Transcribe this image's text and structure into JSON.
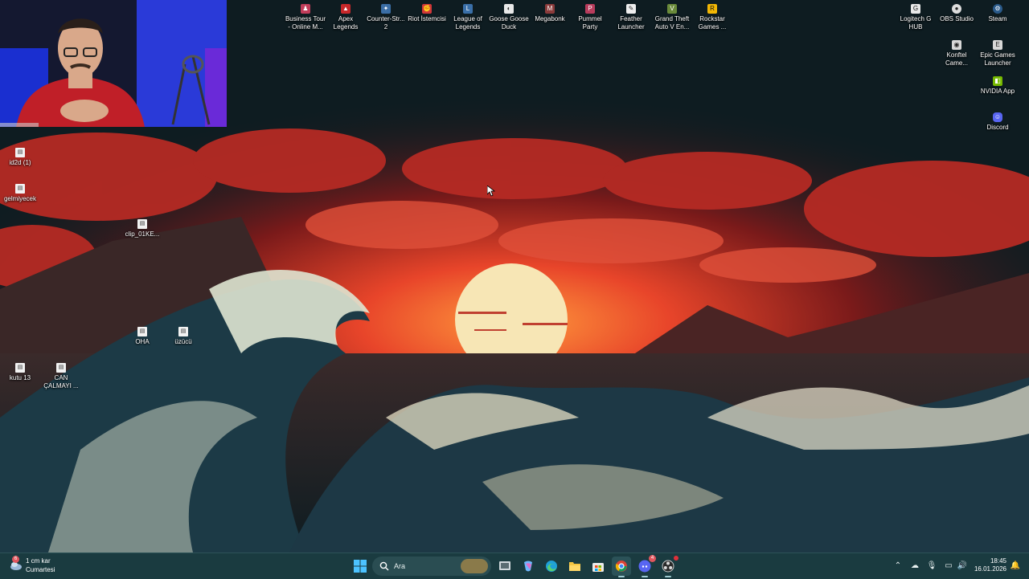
{
  "desktop": {
    "top_icons": [
      {
        "label": "Business Tour\n- Online M...",
        "icon": "business-tour-icon",
        "color": "#c23d5a"
      },
      {
        "label": "Apex\nLegends",
        "icon": "apex-legends-icon",
        "color": "#c8282a"
      },
      {
        "label": "Counter-Str...\n2",
        "icon": "counter-strike-icon",
        "color": "#3b6ea5"
      },
      {
        "label": "Riot İstemcisi",
        "icon": "riot-client-icon",
        "color": "#d13639"
      },
      {
        "label": "League of\nLegends",
        "icon": "league-of-legends-icon",
        "color": "#3a6fa8"
      },
      {
        "label": "Goose Goose\nDuck",
        "icon": "goose-goose-duck-icon",
        "color": "#e8e8e8"
      },
      {
        "label": "Megabonk",
        "icon": "megabonk-icon",
        "color": "#8a3b3b"
      },
      {
        "label": "Pummel\nParty",
        "icon": "pummel-party-icon",
        "color": "#b83c5c"
      },
      {
        "label": "Feather\nLauncher",
        "icon": "feather-launcher-icon",
        "color": "#eeeeee"
      },
      {
        "label": "Grand Theft\nAuto V En...",
        "icon": "gta-v-icon",
        "color": "#6a8a3a"
      },
      {
        "label": "Rockstar\nGames ...",
        "icon": "rockstar-games-icon",
        "color": "#f2b705"
      }
    ],
    "right_icons": [
      {
        "label": "Logitech G\nHUB",
        "icon": "logitech-g-hub-icon",
        "color": "#e8e8e8"
      },
      {
        "label": "OBS Studio",
        "icon": "obs-studio-icon",
        "color": "#dddddd"
      },
      {
        "label": "Steam",
        "icon": "steam-icon",
        "color": "#2a5a8a"
      },
      {
        "label": "Konftel\nCame...",
        "icon": "konftel-camera-icon",
        "color": "#d8d8d8"
      },
      {
        "label": "Epic Games\nLauncher",
        "icon": "epic-games-icon",
        "color": "#d8d8d8"
      },
      {
        "label": "NVIDIA App",
        "icon": "nvidia-app-icon",
        "color": "#76b900"
      },
      {
        "label": "Discord",
        "icon": "discord-icon",
        "color": "#5865f2"
      }
    ],
    "left_icons": [
      {
        "label": "id2d (1)",
        "icon": "file-icon"
      },
      {
        "label": "gelmiyecek",
        "icon": "file-icon"
      },
      {
        "label": "clip_01KE...",
        "icon": "file-icon"
      },
      {
        "label": "OHA",
        "icon": "file-icon"
      },
      {
        "label": "üzücü",
        "icon": "file-icon"
      },
      {
        "label": "kutu 13",
        "icon": "file-icon"
      },
      {
        "label": "CAN\nÇALMAYI ...",
        "icon": "file-icon"
      }
    ]
  },
  "taskbar": {
    "weather": {
      "temp": "1 cm kar",
      "day": "Cumartesi",
      "badge": "6"
    },
    "search_placeholder": "Ara",
    "apps": [
      {
        "name": "start-button",
        "icon": "windows-icon"
      },
      {
        "name": "search",
        "icon": "search-icon"
      },
      {
        "name": "task-view-button",
        "icon": "task-view-icon"
      },
      {
        "name": "copilot-button",
        "icon": "copilot-icon"
      },
      {
        "name": "edge-button",
        "icon": "edge-icon"
      },
      {
        "name": "file-explorer-button",
        "icon": "folder-icon"
      },
      {
        "name": "store-button",
        "icon": "store-icon"
      },
      {
        "name": "chrome-button",
        "icon": "chrome-icon"
      },
      {
        "name": "discord-button",
        "icon": "discord-icon",
        "badge": "4"
      },
      {
        "name": "obs-button",
        "icon": "obs-icon"
      }
    ],
    "clock": {
      "time": "18:45",
      "date": "16.01.2026"
    }
  },
  "colors": {
    "taskbar": "#1a3b40",
    "sky": "#0e1c21",
    "sun": "#f7e6b5"
  }
}
